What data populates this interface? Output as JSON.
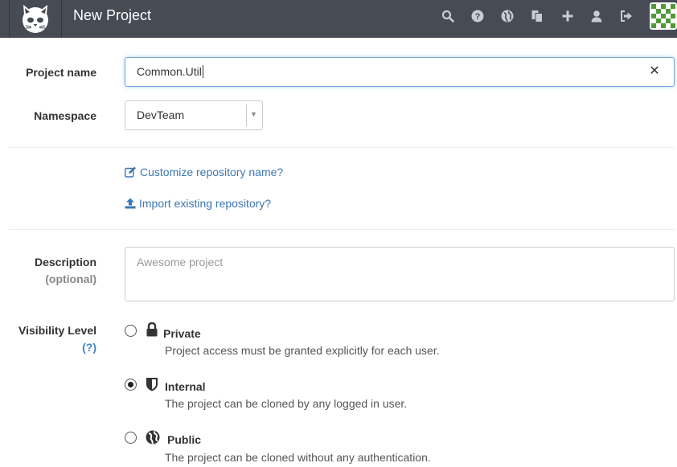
{
  "header": {
    "title": "New Project",
    "icons": [
      "search-icon",
      "help-icon",
      "globe-icon",
      "copy-icon",
      "plus-icon",
      "user-icon",
      "sign-out-icon"
    ],
    "bg_color": "#464b54"
  },
  "form": {
    "project_name": {
      "label": "Project name",
      "value": "Common.Util"
    },
    "namespace": {
      "label": "Namespace",
      "value": "DevTeam"
    },
    "links": {
      "customize": "Customize repository name?",
      "import": "Import existing repository?"
    },
    "description": {
      "label": "Description",
      "sublabel": "(optional)",
      "placeholder": "Awesome project"
    },
    "visibility": {
      "label": "Visibility Level",
      "help": "(?)",
      "options": [
        {
          "name": "Private",
          "icon": "lock-icon",
          "description": "Project access must be granted explicitly for each user.",
          "checked": false
        },
        {
          "name": "Internal",
          "icon": "shield-icon",
          "description": "The project can be cloned by any logged in user.",
          "checked": true
        },
        {
          "name": "Public",
          "icon": "globe-icon",
          "description": "The project can be cloned without any authentication.",
          "checked": false
        }
      ]
    }
  },
  "colors": {
    "link": "#3d77b4",
    "focus_border": "#7aa8d8"
  }
}
